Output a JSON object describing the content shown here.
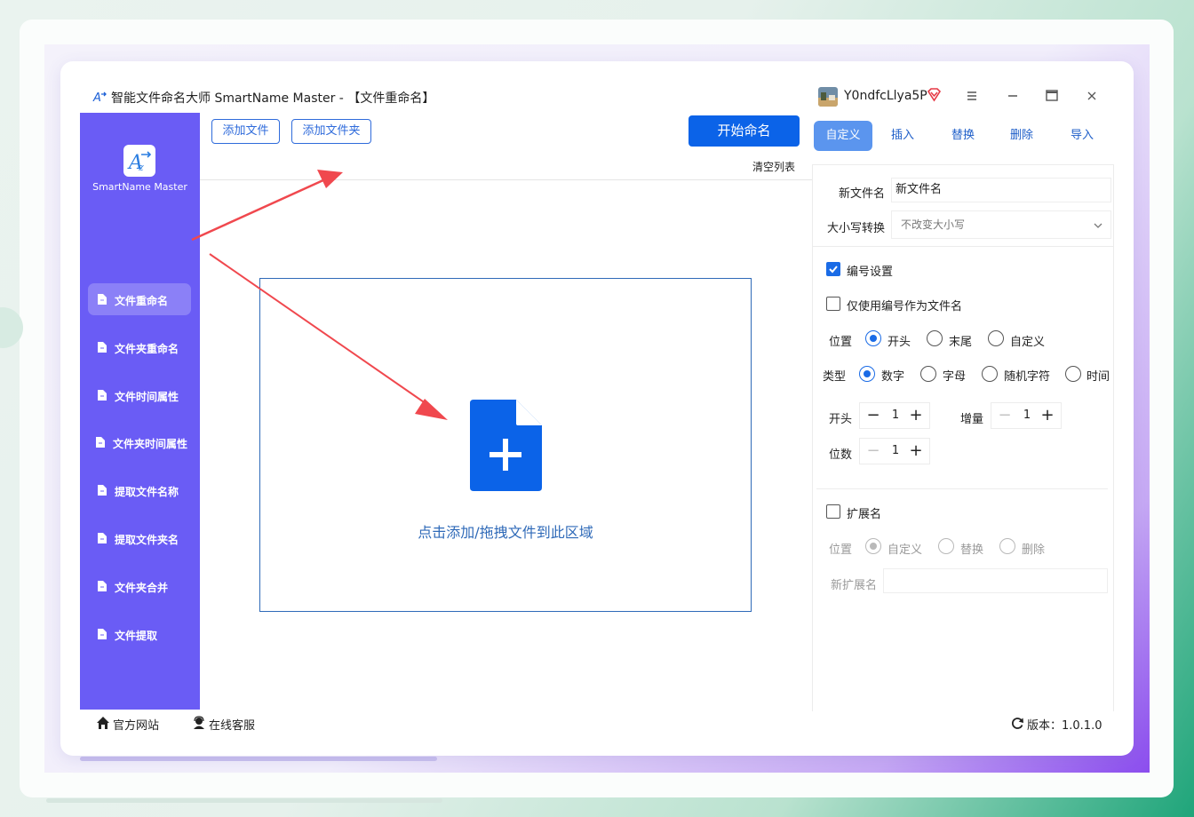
{
  "window": {
    "title": "智能文件命名大师 SmartName Master - 【文件重命名】",
    "user_name": "Y0ndfcLlya5P"
  },
  "sidebar": {
    "logo_text": "SmartName Master",
    "items": [
      {
        "label": "文件重命名"
      },
      {
        "label": "文件夹重命名"
      },
      {
        "label": "文件时间属性"
      },
      {
        "label": "文件夹时间属性"
      },
      {
        "label": "提取文件名称"
      },
      {
        "label": "提取文件夹名"
      },
      {
        "label": "文件夹合并"
      },
      {
        "label": "文件提取"
      }
    ]
  },
  "toolbar": {
    "add_file": "添加文件",
    "add_folder": "添加文件夹",
    "start": "开始命名",
    "clear_list": "清空列表"
  },
  "drop_zone": {
    "text": "点击添加/拖拽文件到此区域"
  },
  "tabs": [
    "自定义",
    "插入",
    "替换",
    "删除",
    "导入"
  ],
  "settings": {
    "new_name_label": "新文件名",
    "new_name_value": "新文件名",
    "case_label": "大小写转换",
    "case_value": "不改变大小写",
    "numbering_label": "编号设置",
    "numbering_only_label": "仅使用编号作为文件名",
    "position_label": "位置",
    "position_options": [
      "开头",
      "末尾",
      "自定义"
    ],
    "type_label": "类型",
    "type_options": [
      "数字",
      "字母",
      "随机字符",
      "时间"
    ],
    "start_label": "开头",
    "start_value": "1",
    "increment_label": "增量",
    "increment_value": "1",
    "digits_label": "位数",
    "digits_value": "1",
    "ext_label": "扩展名",
    "ext_position_label": "位置",
    "ext_position_options": [
      "自定义",
      "替换",
      "删除"
    ],
    "new_ext_label": "新扩展名",
    "new_ext_value": ""
  },
  "footer": {
    "website": "官方网站",
    "support": "在线客服",
    "version": "版本：1.0.1.0"
  },
  "colors": {
    "sidebar": "#6a5cf5",
    "primary": "#0b63e8",
    "arrow": "#f0484e"
  }
}
